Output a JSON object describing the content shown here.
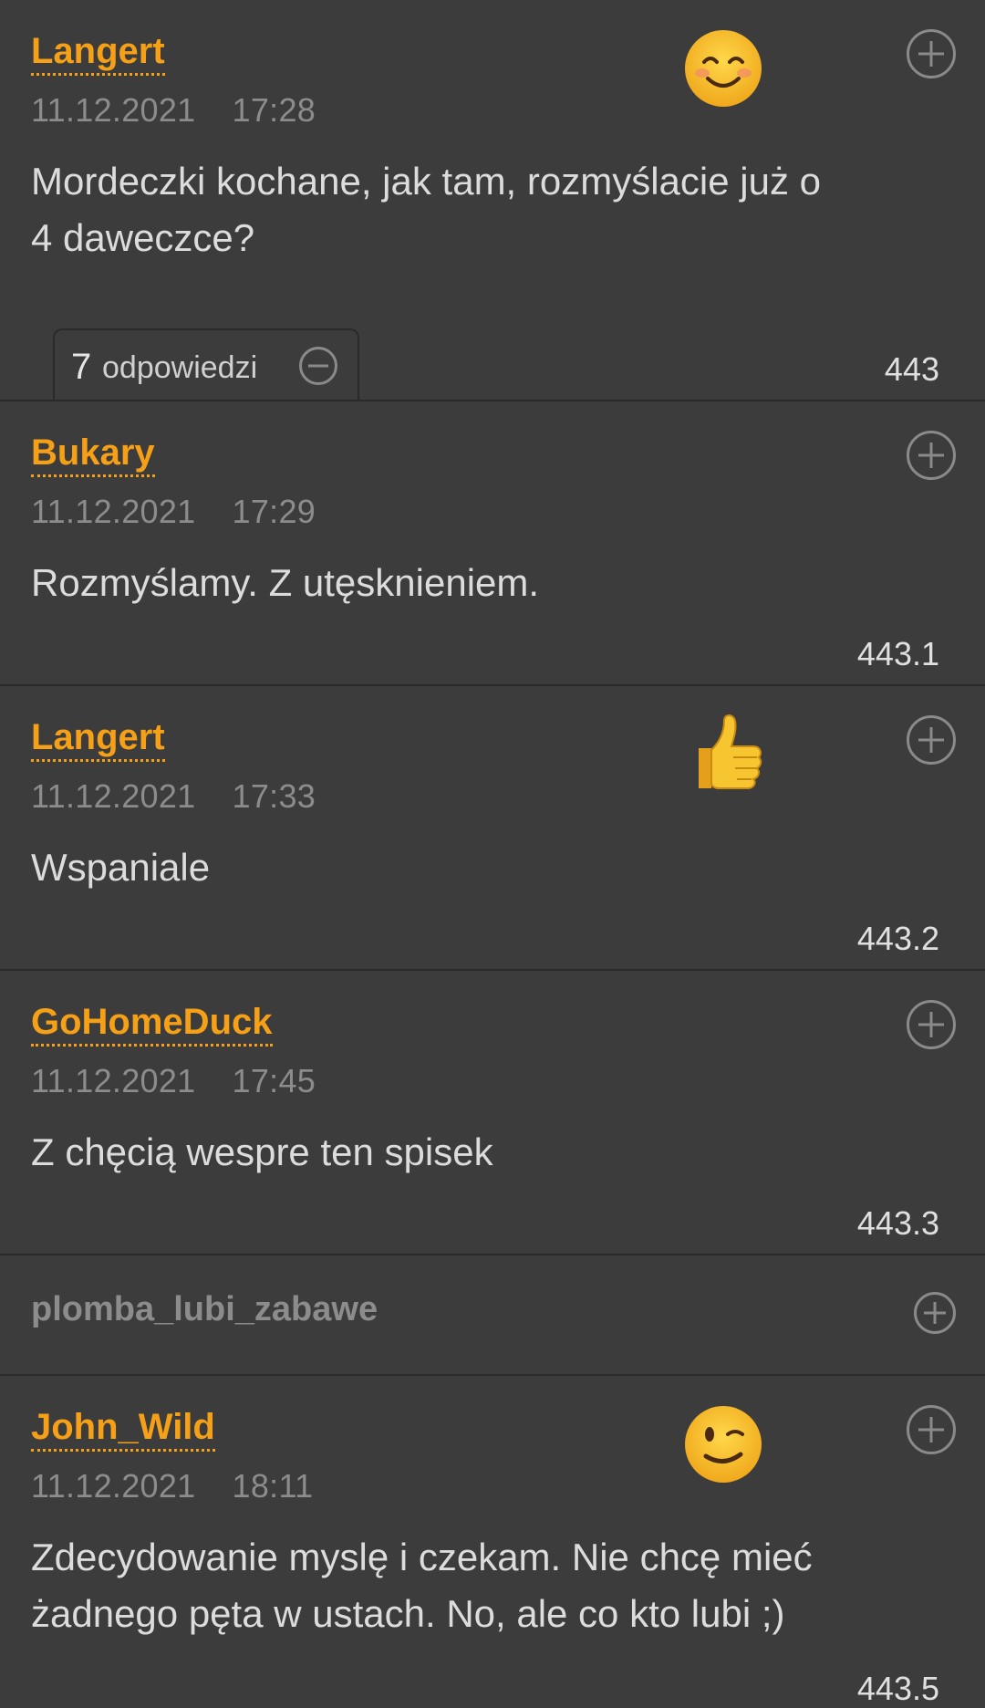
{
  "thread": {
    "root": {
      "author": "Langert",
      "date": "11.12.2021",
      "time": "17:28",
      "text_line1": "Mordeczki kochane, jak tam, rozmyślacie już o",
      "text_line2": "4 daweczce?",
      "reaction": "smiling-face-emoji",
      "number": "443"
    },
    "replies_tab": {
      "count": "7",
      "label": "odpowiedzi"
    },
    "replies": [
      {
        "author": "Bukary",
        "date": "11.12.2021",
        "time": "17:29",
        "text": "Rozmyślamy. Z utęsknieniem.",
        "number": "443.1"
      },
      {
        "author": "Langert",
        "date": "11.12.2021",
        "time": "17:33",
        "text": "Wspaniale",
        "number": "443.2",
        "reaction": "thumbs-up-emoji"
      },
      {
        "author": "GoHomeDuck",
        "date": "11.12.2021",
        "time": "17:45",
        "text": "Z chęcią wespre ten spisek",
        "number": "443.3"
      },
      {
        "author": "plomba_lubi_zabawe",
        "collapsed": true
      },
      {
        "author": "John_Wild",
        "date": "11.12.2021",
        "time": "18:11",
        "text_line1": "Zdecydowanie myslę i czekam. Nie chcę mieć",
        "text_line2": "żadnego pęta w ustach. No, ale co kto lubi ;)",
        "number": "443.5",
        "reaction": "winking-face-emoji"
      }
    ]
  },
  "colors": {
    "background": "#3c3c3c",
    "author": "#f5a016",
    "meta": "#8c8c8c",
    "text": "#dcdcdc",
    "divider": "#2a2a2a"
  }
}
